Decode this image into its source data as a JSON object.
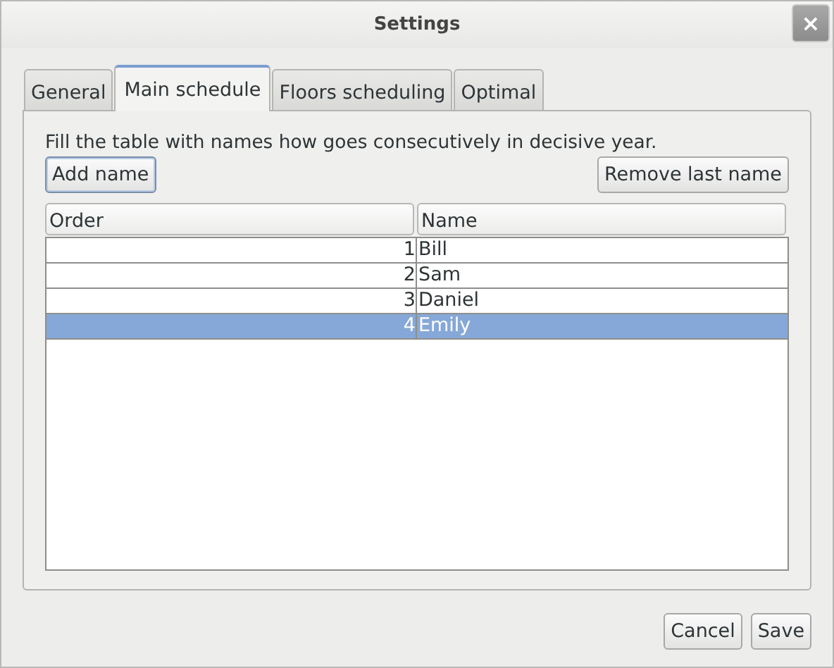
{
  "window": {
    "title": "Settings",
    "close": "×"
  },
  "tabs": [
    {
      "label": "General",
      "selected": false
    },
    {
      "label": "Main schedule",
      "selected": true
    },
    {
      "label": "Floors scheduling",
      "selected": false
    },
    {
      "label": "Optimal",
      "selected": false
    }
  ],
  "instruction": "Fill the table with names how goes consecutively in decisive year.",
  "add_button": "Add name",
  "remove_button": "Remove last name",
  "table": {
    "columns": [
      "Order",
      "Name"
    ],
    "rows": [
      {
        "order": "1",
        "name": "Bill",
        "selected": false
      },
      {
        "order": "2",
        "name": "Sam",
        "selected": false
      },
      {
        "order": "3",
        "name": "Daniel",
        "selected": false
      },
      {
        "order": "4",
        "name": "Emily",
        "selected": true
      }
    ]
  },
  "buttons": [
    "Cancel",
    "Save"
  ]
}
